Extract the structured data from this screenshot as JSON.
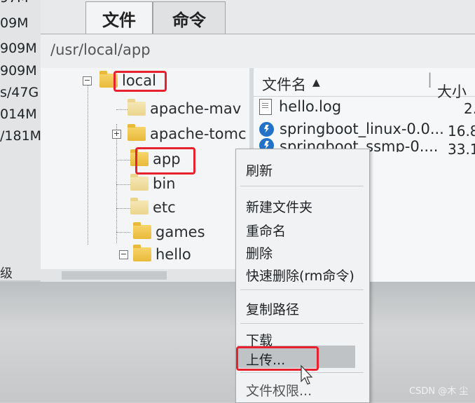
{
  "left_strip": {
    "sizes": [
      "97M",
      "09M",
      "909M",
      "909M",
      "s/47G",
      "014M",
      "/181M"
    ]
  },
  "tabs": [
    {
      "label": "文件"
    },
    {
      "label": "命令"
    }
  ],
  "path": "/usr/local/app",
  "tree": {
    "items": [
      {
        "label": "local"
      },
      {
        "label": "apache-mav"
      },
      {
        "label": "apache-tomc"
      },
      {
        "label": "app"
      },
      {
        "label": "bin"
      },
      {
        "label": "etc"
      },
      {
        "label": "games"
      },
      {
        "label": "hello"
      }
    ],
    "status": "级"
  },
  "file_list": {
    "columns": {
      "name": "文件名",
      "sort_indicator": "▲",
      "size": "大小"
    },
    "rows": [
      {
        "name": "hello.log",
        "size": "2."
      },
      {
        "name": "springboot_linux-0.0...",
        "size": "16.8"
      },
      {
        "name": "springboot_ssmp-0....",
        "size": "33.1"
      }
    ]
  },
  "context_menu": {
    "items": [
      "刷新",
      "新建文件夹",
      "重命名",
      "删除",
      "快速删除(rm命令)",
      "复制路径",
      "下载",
      "上传...",
      "文件权限..."
    ]
  },
  "watermark": "CSDN @木 尘",
  "colors": {
    "highlight": "#e8212e",
    "menu_hover": "#c0c3c5",
    "folder": "#e9b93a",
    "jar_icon": "#2472c8"
  }
}
